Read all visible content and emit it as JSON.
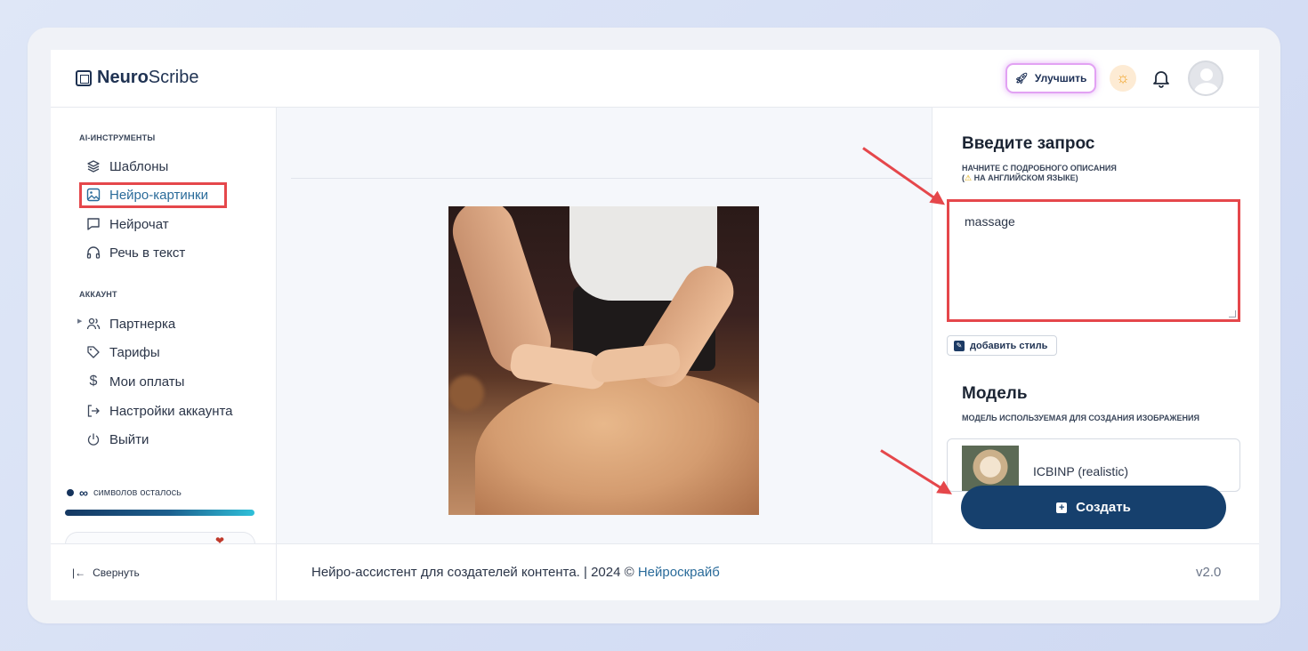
{
  "app": {
    "logo_bold": "Neuro",
    "logo_regular": "Scribe"
  },
  "header": {
    "upgrade_label": "Улучшить"
  },
  "sidebar": {
    "section_tools": "AI-ИНСТРУМЕНТЫ",
    "tools": [
      {
        "label": "Шаблоны",
        "icon": "layers-icon"
      },
      {
        "label": "Нейро-картинки",
        "icon": "image-icon",
        "active": true
      },
      {
        "label": "Нейрочат",
        "icon": "chat-icon"
      },
      {
        "label": "Речь в текст",
        "icon": "headphones-icon"
      }
    ],
    "section_account": "АККАУНТ",
    "account": [
      {
        "label": "Партнерка",
        "icon": "users-icon"
      },
      {
        "label": "Тарифы",
        "icon": "tag-icon"
      },
      {
        "label": "Мои оплаты",
        "icon": "dollar-icon"
      },
      {
        "label": "Настройки аккаунта",
        "icon": "login-icon"
      },
      {
        "label": "Выйти",
        "icon": "power-icon"
      }
    ],
    "symbols_infinity": "∞",
    "symbols_text": "символов осталось",
    "collapse_label": "Свернуть"
  },
  "panel": {
    "prompt_title": "Введите запрос",
    "prompt_hint_line1": "НАЧНИТЕ С ПОДРОБНОГО ОПИСАНИЯ",
    "prompt_hint_line2": "НА АНГЛИЙСКОМ ЯЗЫКЕ)",
    "prompt_value": "massage",
    "add_style_label": "добавить стиль",
    "model_title": "Модель",
    "model_hint": "МОДЕЛЬ ИСПОЛЬЗУЕМАЯ ДЛЯ СОЗДАНИЯ ИЗОБРАЖЕНИЯ",
    "model_name": "ICBINP (realistic)",
    "create_label": "Создать"
  },
  "footer": {
    "text": "Нейро-ассистент для создателей контента.  | 2024 © ",
    "link": "Нейроскрайб",
    "version": "v2.0"
  },
  "colors": {
    "brand": "#16406d",
    "highlight": "#e5474b",
    "active": "#2a6b9a"
  }
}
